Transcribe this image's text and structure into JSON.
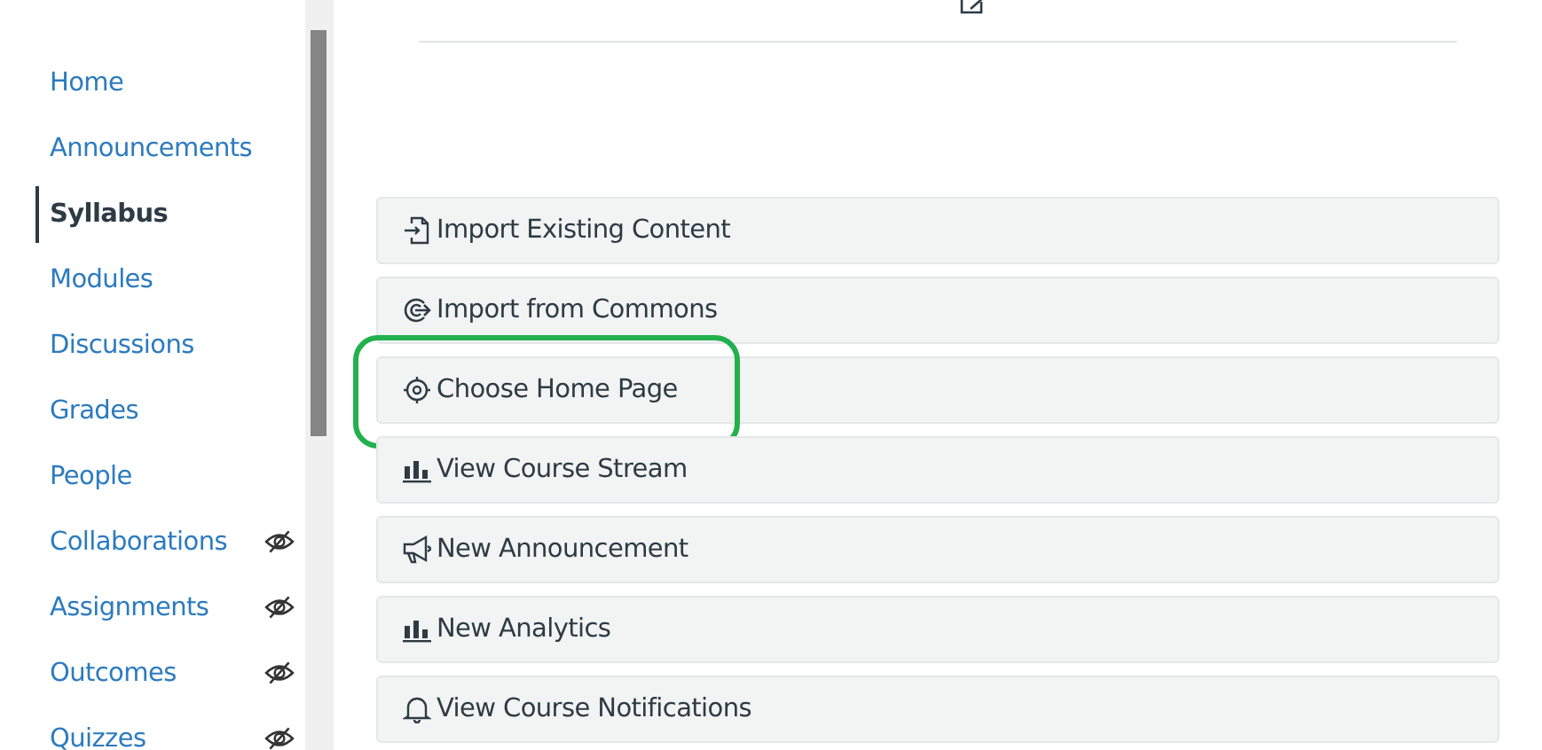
{
  "nav": [
    {
      "label": "Home",
      "selected": false,
      "hidden": false
    },
    {
      "label": "Announcements",
      "selected": false,
      "hidden": false
    },
    {
      "label": "Syllabus",
      "selected": true,
      "hidden": false
    },
    {
      "label": "Modules",
      "selected": false,
      "hidden": false
    },
    {
      "label": "Discussions",
      "selected": false,
      "hidden": false
    },
    {
      "label": "Grades",
      "selected": false,
      "hidden": false
    },
    {
      "label": "People",
      "selected": false,
      "hidden": false
    },
    {
      "label": "Collaborations",
      "selected": false,
      "hidden": true
    },
    {
      "label": "Assignments",
      "selected": false,
      "hidden": true
    },
    {
      "label": "Outcomes",
      "selected": false,
      "hidden": true
    },
    {
      "label": "Quizzes",
      "selected": false,
      "hidden": true
    }
  ],
  "actions": [
    {
      "label": "Import Existing Content",
      "kind": "import",
      "highlighted": false
    },
    {
      "label": "Import from Commons",
      "kind": "commons",
      "highlighted": false
    },
    {
      "label": "Choose Home Page",
      "kind": "target",
      "highlighted": true
    },
    {
      "label": "View Course Stream",
      "kind": "chart",
      "highlighted": false
    },
    {
      "label": "New Announcement",
      "kind": "megaphone",
      "highlighted": false
    },
    {
      "label": "New Analytics",
      "kind": "chart",
      "highlighted": false
    },
    {
      "label": "View Course Notifications",
      "kind": "bell",
      "highlighted": false
    }
  ]
}
